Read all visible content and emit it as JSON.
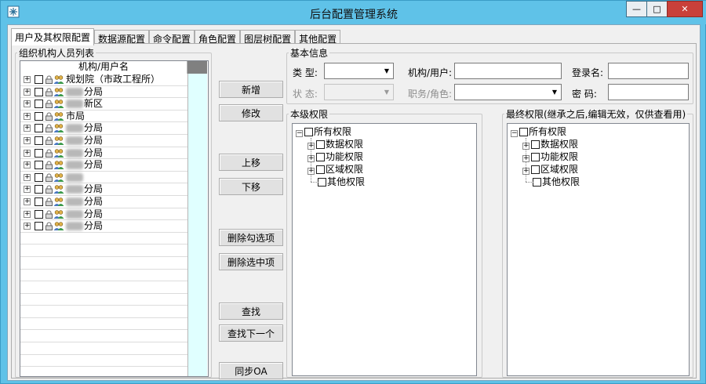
{
  "window": {
    "title": "后台配置管理系统",
    "minimize": "—",
    "maximize": "□",
    "close": "✕"
  },
  "tabs": [
    "用户及其权限配置",
    "数据源配置",
    "命令配置",
    "角色配置",
    "图层树配置",
    "其他配置"
  ],
  "org_panel": {
    "legend": "组织机构人员列表",
    "column_header": "机构/用户名",
    "rows": [
      {
        "prefix": "",
        "label": "规划院（市政工程所）"
      },
      {
        "prefix": "blur",
        "label": "分局"
      },
      {
        "prefix": "blur",
        "label": "新区"
      },
      {
        "prefix": "",
        "label": "市局"
      },
      {
        "prefix": "blur",
        "label": "分局"
      },
      {
        "prefix": "blur",
        "label": "分局"
      },
      {
        "prefix": "blur",
        "label": "分局"
      },
      {
        "prefix": "blur",
        "label": "分局"
      },
      {
        "prefix": "blur",
        "label": ""
      },
      {
        "prefix": "blur",
        "label": "分局"
      },
      {
        "prefix": "blur",
        "label": "分局"
      },
      {
        "prefix": "blur",
        "label": "分局"
      },
      {
        "prefix": "blur",
        "label": "分局"
      }
    ]
  },
  "buttons": {
    "add": "新增",
    "edit": "修改",
    "move_up": "上移",
    "move_down": "下移",
    "delete_checked": "删除勾选项",
    "delete_selected": "删除选中项",
    "find": "查找",
    "find_next": "查找下一个",
    "sync_oa": "同步OA"
  },
  "basic_info": {
    "legend": "基本信息",
    "type_label": "类 型:",
    "type_value": "",
    "org_user_label": "机构/用户:",
    "org_user_value": "",
    "login_label": "登录名:",
    "login_value": "",
    "status_label": "状 态:",
    "status_value": "",
    "post_role_label": "职务/角色:",
    "post_role_value": "",
    "password_label": "密  码:",
    "password_value": ""
  },
  "level_perm": {
    "legend": "本级权限",
    "root": "所有权限",
    "children": [
      "数据权限",
      "功能权限",
      "区域权限",
      "其他权限"
    ]
  },
  "final_perm": {
    "legend": "最终权限(继承之后,编辑无效，仅供查看用)",
    "root": "所有权限",
    "children": [
      "数据权限",
      "功能权限",
      "区域权限",
      "其他权限"
    ]
  }
}
